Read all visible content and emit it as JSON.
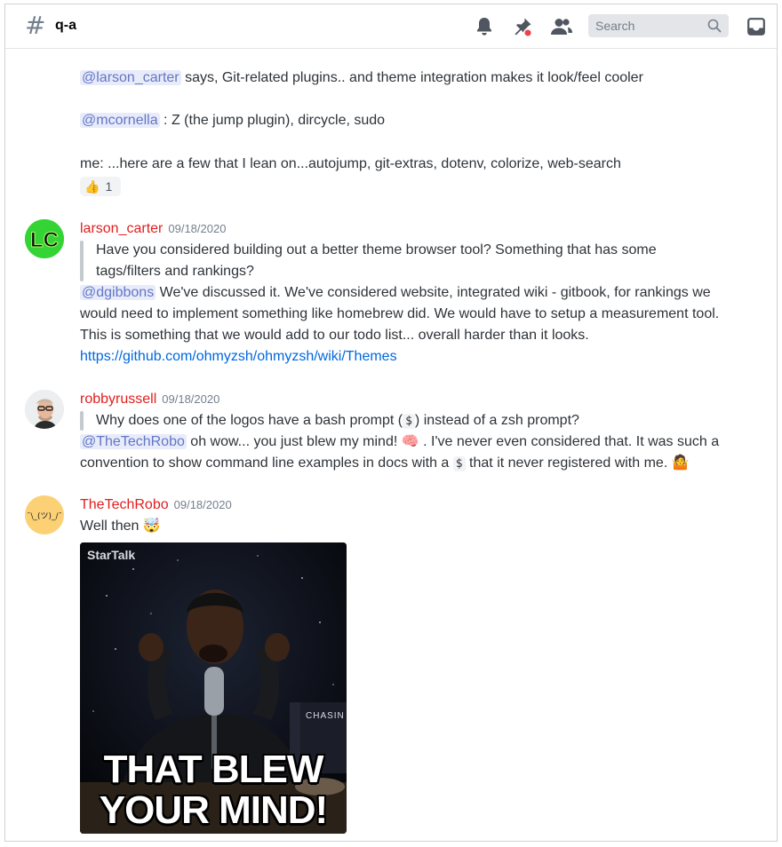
{
  "header": {
    "channel_name": "q-a",
    "search_placeholder": "Search",
    "icons": [
      "bell-icon",
      "pin-icon",
      "members-icon",
      "search-icon",
      "inbox-icon"
    ]
  },
  "messages": {
    "m0": {
      "line1_mention": "@larson_carter",
      "line1_text": " says, Git-related plugins.. and theme integration makes it look/feel cooler",
      "line2_mention": "@mcornella",
      "line2_text": " : Z (the jump plugin), dircycle, sudo",
      "line3_text": "me: ...here are a few that I lean on...autojump, git-extras, dotenv, colorize, web-search",
      "reaction_emoji": "👍",
      "reaction_count": "1"
    },
    "m1": {
      "author": "larson_carter",
      "timestamp": "09/18/2020",
      "quote_line1": "Have you considered building out a better theme browser tool? Something that has some",
      "quote_line2": "tags/filters and rankings?",
      "mention": "@dgibbons",
      "body1": " We've discussed it. We've considered website, integrated wiki - gitbook, for rankings we",
      "body2": "would need to implement something like homebrew did. We would have to setup a measurement tool.",
      "body3": "This is something that we would add to our todo list... overall harder than it looks.",
      "link": "https://github.com/ohmyzsh/ohmyzsh/wiki/Themes"
    },
    "m2": {
      "author": "robbyrussell",
      "timestamp": "09/18/2020",
      "quote_a": "Why does one of the logos have a bash prompt (",
      "quote_code": "$",
      "quote_b": ") instead of a zsh prompt?",
      "mention": "@TheTechRobo",
      "body1": " oh wow... you just blew my mind! ",
      "body1_emoji": "🧠",
      "body1_tail": " . I've never even considered that. It was such a",
      "body2a": "convention to show command line examples in docs with a ",
      "body2_code": "$",
      "body2b": " that it never registered with me. ",
      "body2_emoji": "🤷"
    },
    "m3": {
      "author": "TheTechRobo",
      "timestamp": "09/18/2020",
      "body": "Well then ",
      "body_emoji": "🤯",
      "avatar_text": "¯\\_(ツ)_/¯",
      "gif_brand": "StarTalk",
      "gif_caption1": "THAT BLEW",
      "gif_caption2": "YOUR MIND!",
      "gif_book_text": "CHASIN"
    }
  },
  "colors": {
    "author": "#e0201e",
    "mention_bg": "#e8ebfa",
    "mention_fg": "#6277c6",
    "link": "#0068e0"
  }
}
